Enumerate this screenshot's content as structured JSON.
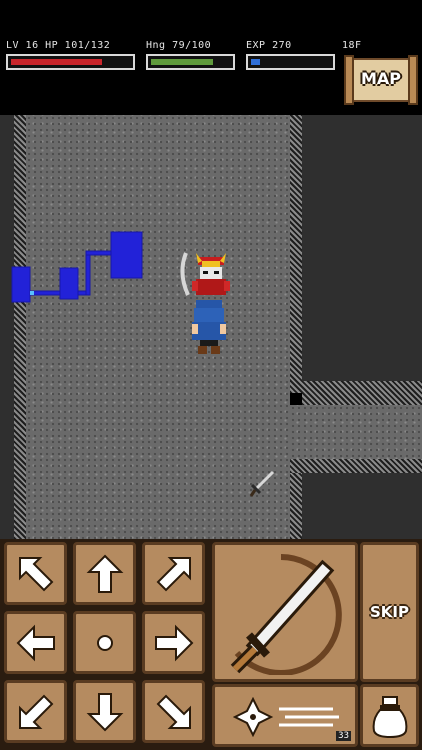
{
  "hud": {
    "level_hp": "LV 16 HP 101/132",
    "hunger": "Hng 79/100",
    "exp": "EXP 270",
    "floor": "18F",
    "hp": {
      "current": 101,
      "max": 132,
      "color": "#c8252b"
    },
    "hunger_bar": {
      "current": 79,
      "max": 100,
      "color": "#5f9a3c"
    },
    "exp_bar": {
      "fill": 0.12,
      "color": "#2f6fd8"
    },
    "map_label": "MAP"
  },
  "dungeon": {
    "floor_color": "#6a6a6a",
    "wall_color": "#2f2f2f",
    "minimap_color": "#2222d8",
    "player": "player-character",
    "enemy": "red-samurai-enemy",
    "item": "sword-item"
  },
  "controls": {
    "dpad": [
      "up-left",
      "up",
      "up-right",
      "left",
      "wait",
      "right",
      "down-left",
      "down",
      "down-right"
    ],
    "attack_icon": "sword-attack-icon",
    "skip_label": "SKIP",
    "throw_count": "33",
    "button_color": "#b58b60"
  }
}
